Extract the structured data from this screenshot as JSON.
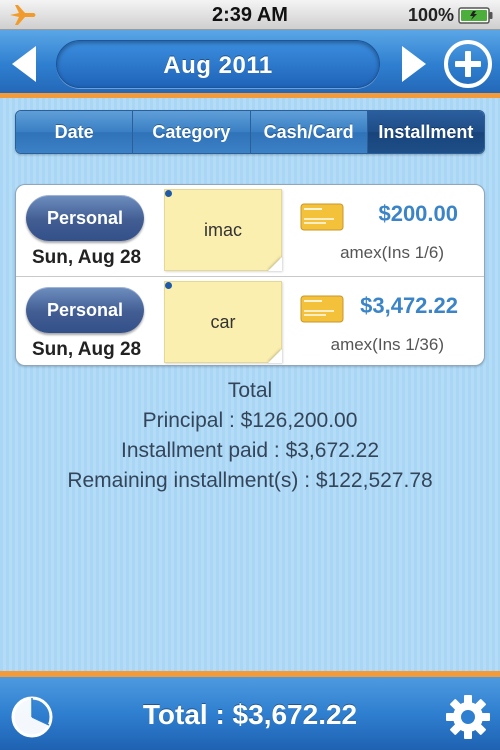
{
  "status_bar": {
    "time": "2:39 AM",
    "battery_text": "100%",
    "airplane_icon": "airplane-icon",
    "battery_icon": "battery-icon"
  },
  "nav": {
    "title": "Aug 2011",
    "prev_icon": "left-arrow-icon",
    "next_icon": "right-arrow-icon",
    "add_icon": "plus-circle-icon"
  },
  "tabs": [
    {
      "label": "Date",
      "active": false
    },
    {
      "label": "Category",
      "active": false
    },
    {
      "label": "Cash/Card",
      "active": false
    },
    {
      "label": "Installment",
      "active": true
    }
  ],
  "entries": [
    {
      "category": "Personal",
      "date": "Sun, Aug 28",
      "note": "imac",
      "amount": "$200.00",
      "detail": "amex(Ins 1/6)",
      "card_icon": "credit-card-icon"
    },
    {
      "category": "Personal",
      "date": "Sun, Aug 28",
      "note": "car",
      "amount": "$3,472.22",
      "detail": "amex(Ins 1/36)",
      "card_icon": "credit-card-icon"
    }
  ],
  "totals": {
    "heading": "Total",
    "principal": "Principal : $126,200.00",
    "paid": "Installment paid : $3,672.22",
    "remaining": "Remaining installment(s) : $122,527.78"
  },
  "bottom_bar": {
    "total": "Total : $3,672.22",
    "pie_icon": "pie-chart-icon",
    "settings_icon": "gear-icon"
  },
  "colors": {
    "accent_orange": "#f39a3a",
    "nav_blue": "#2f7fd0",
    "amount_blue": "#3a84c7",
    "background_blue": "#b4dcf7"
  }
}
